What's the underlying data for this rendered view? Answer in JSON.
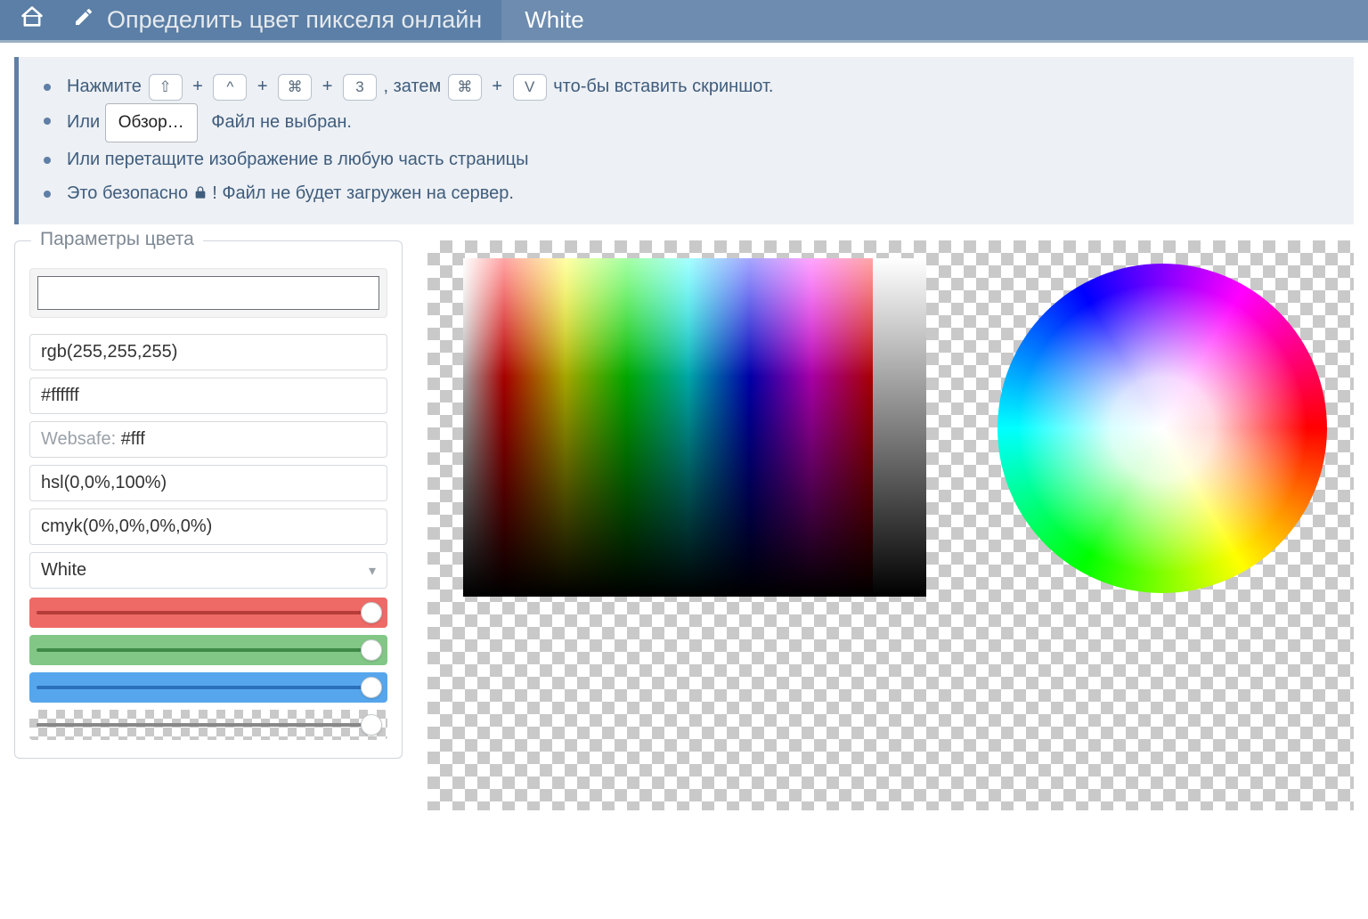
{
  "header": {
    "title": "Определить цвет пикселя онлайн",
    "color_name": "White"
  },
  "instructions": {
    "line1_a": "Нажмите",
    "line1_b": ", затем",
    "line1_c": "что-бы вставить скриншот.",
    "key_shift": "⇧",
    "key_ctrl": "^",
    "key_cmd": "⌘",
    "key_3": "3",
    "key_v": "V",
    "plus": "+",
    "line2_or": "Или",
    "browse": "Обзор…",
    "no_file": "Файл не выбран.",
    "line3": "Или перетащите изображение в любую часть страницы",
    "line4_a": "Это безопасно ",
    "line4_b": "! Файл не будет загружен на сервер."
  },
  "params": {
    "legend": "Параметры цвета",
    "rgb": "rgb(255,255,255)",
    "hex": "#ffffff",
    "websafe_label": "Websafe: ",
    "websafe_value": "#fff",
    "hsl": "hsl(0,0%,100%)",
    "cmyk": "cmyk(0%,0%,0%,0%)",
    "name": "White"
  },
  "sliders": {
    "r": 255,
    "g": 255,
    "b": 255,
    "a": 255,
    "max": 255
  },
  "colors": {
    "header_bg": "#5b7fa6",
    "header_color_bg": "#6d8caf",
    "accent": "#5f7fa6"
  }
}
